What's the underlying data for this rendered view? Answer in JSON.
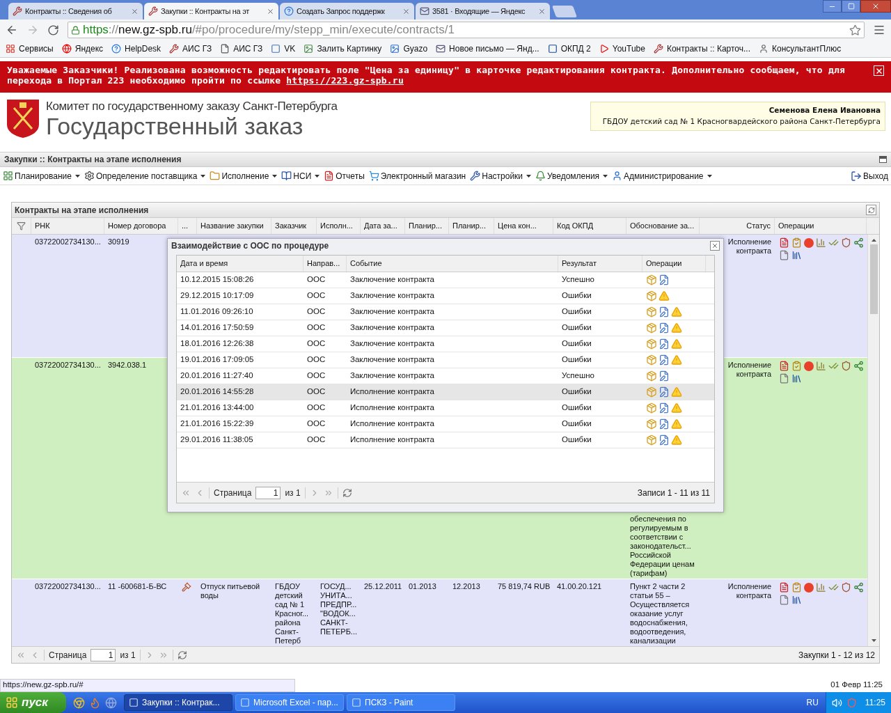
{
  "browser": {
    "tabs": [
      {
        "title": "Контракты :: Сведения об",
        "selected": false
      },
      {
        "title": "Закупки :: Контракты на эт",
        "selected": true
      },
      {
        "title": "Создать Запрос поддержк",
        "selected": false
      },
      {
        "title": "3581 · Входящие — Яндекс",
        "selected": false
      }
    ],
    "url": {
      "scheme": "https",
      "sep": "://",
      "host": "new.gz-spb.ru",
      "path": "/#po/procedure/my/stepp_min/execute/contracts/1"
    },
    "bookmarks": [
      "Сервисы",
      "Яндекс",
      "HelpDesk",
      "АИС ГЗ",
      "АИС ГЗ",
      "VK",
      "Залить Картинку",
      "Gyazo",
      "Новое письмо — Янд...",
      "ОКПД 2",
      "YouTube",
      "Контракты :: Карточ...",
      "КонсультантПлюс"
    ]
  },
  "banner": {
    "text": "Уважаемые Заказчики! Реализована возможность редактировать поле \"Цена за единицу\" в карточке редактирования контракта. Дополнительно сообщаем, что для перехода в Портал 223 необходимо пройти по ссылке",
    "link": "https://223.gz-spb.ru"
  },
  "header": {
    "org": "Комитет по государственному заказу Санкт-Петербурга",
    "title": "Государственный заказ",
    "user_name": "Семенова Елена Ивановна",
    "user_org": "ГБДОУ детский сад № 1 Красногвардейского района Санкт-Петербурга"
  },
  "window_title": "Закупки :: Контракты на этапе исполнения",
  "menu": [
    {
      "label": "Планирование",
      "dropdown": true
    },
    {
      "label": "Определение поставщика",
      "dropdown": true
    },
    {
      "label": "Исполнение",
      "dropdown": true
    },
    {
      "label": "НСИ",
      "dropdown": true
    },
    {
      "label": "Отчеты",
      "dropdown": false
    },
    {
      "label": "Электронный магазин",
      "dropdown": false
    },
    {
      "label": "Настройки",
      "dropdown": true
    },
    {
      "label": "Уведомления",
      "dropdown": true
    },
    {
      "label": "Администрирование",
      "dropdown": true
    }
  ],
  "logout": "Выход",
  "table": {
    "title": "Контракты на этапе исполнения",
    "columns": [
      "РНК",
      "Номер договора",
      "...",
      "Название закупки",
      "Заказчик",
      "Исполн...",
      "Дата за...",
      "Планир...",
      "Планир...",
      "Цена кон...",
      "Код ОКПД",
      "Обоснование за...",
      "Статус",
      "Операции"
    ],
    "rows": [
      {
        "color": "#e3e4fa",
        "rnk": "03722002734130...",
        "number": "30919",
        "status": "Исполнение контракта"
      },
      {
        "color": "#d0efc0",
        "rnk": "03722002734130...",
        "number": "3942.038.1",
        "justification_end": "обеспечения по регулируемым в соответствии с законодательст... Российской Федерации ценам (тарифам)",
        "status": "Исполнение контракта"
      },
      {
        "color": "#e3e4fa",
        "rnk": "03722002734130...",
        "number": "11 -600681-Б-ВС",
        "auction_icon": true,
        "name": "Отпуск питьевой воды",
        "customer": "ГБДОУ детский сад № 1 Красног... района Санкт-Петерб",
        "supplier": "ГОСУД... УНИТА... ПРЕДПР... \"ВОДОК... САНКТ-ПЕТЕРБ...",
        "date": "25.12.2011",
        "plan_start": "01.2013",
        "plan_end": "12.2013",
        "price": "75 819,74 RUB",
        "okpd": "41.00.20.121",
        "justification": "Пункт 2 части 2 статьи 55 – Осуществляется оказание услуг водоснабжения, водоотведения, канализации",
        "status": "Исполнение контракта"
      }
    ],
    "pager": {
      "label": "Страница",
      "page": "1",
      "of": "из 1",
      "summary": "Закупки 1 - 12 из 12"
    }
  },
  "dialog": {
    "title": "Взаимодействие с ООС по процедуре",
    "columns": [
      "Дата и время",
      "Направ...",
      "Событие",
      "Результат",
      "Операции"
    ],
    "rows": [
      {
        "datetime": "10.12.2015 15:08:26",
        "direction": "ООС",
        "event": "Заключение контракта",
        "result": "Успешно",
        "document": true,
        "warning": false,
        "selected": false
      },
      {
        "datetime": "29.12.2015 10:17:09",
        "direction": "ООС",
        "event": "Заключение контракта",
        "result": "Ошибки",
        "document": false,
        "warning": true,
        "selected": false
      },
      {
        "datetime": "11.01.2016 09:26:10",
        "direction": "ООС",
        "event": "Заключение контракта",
        "result": "Ошибки",
        "document": true,
        "warning": true,
        "selected": false
      },
      {
        "datetime": "14.01.2016 17:50:59",
        "direction": "ООС",
        "event": "Заключение контракта",
        "result": "Ошибки",
        "document": true,
        "warning": true,
        "selected": false
      },
      {
        "datetime": "18.01.2016 12:26:38",
        "direction": "ООС",
        "event": "Заключение контракта",
        "result": "Ошибки",
        "document": true,
        "warning": true,
        "selected": false
      },
      {
        "datetime": "19.01.2016 17:09:05",
        "direction": "ООС",
        "event": "Заключение контракта",
        "result": "Ошибки",
        "document": true,
        "warning": true,
        "selected": false
      },
      {
        "datetime": "20.01.2016 11:27:40",
        "direction": "ООС",
        "event": "Заключение контракта",
        "result": "Успешно",
        "document": true,
        "warning": false,
        "selected": false
      },
      {
        "datetime": "20.01.2016 14:55:28",
        "direction": "ООС",
        "event": "Исполнение контракта",
        "result": "Ошибки",
        "document": true,
        "warning": true,
        "selected": true
      },
      {
        "datetime": "21.01.2016 13:44:00",
        "direction": "ООС",
        "event": "Исполнение контракта",
        "result": "Ошибки",
        "document": true,
        "warning": true,
        "selected": false
      },
      {
        "datetime": "21.01.2016 15:22:39",
        "direction": "ООС",
        "event": "Исполнение контракта",
        "result": "Ошибки",
        "document": true,
        "warning": true,
        "selected": false
      },
      {
        "datetime": "29.01.2016 11:38:05",
        "direction": "ООС",
        "event": "Исполнение контракта",
        "result": "Ошибки",
        "document": true,
        "warning": true,
        "selected": false
      }
    ],
    "pager": {
      "label": "Страница",
      "page": "1",
      "of": "из 1",
      "summary": "Записи 1 - 11 из 11"
    }
  },
  "status_url": "https://new.gz-spb.ru/#",
  "status_date": "01 Февр 11:25",
  "taskbar": {
    "start": "пуск",
    "tasks": [
      {
        "label": "Закупки :: Контрак...",
        "selected": true
      },
      {
        "label": "Microsoft Excel - пар...",
        "selected": false
      },
      {
        "label": "ПСКЗ - Paint",
        "selected": false
      }
    ],
    "lang": "RU",
    "clock": "11:25"
  }
}
